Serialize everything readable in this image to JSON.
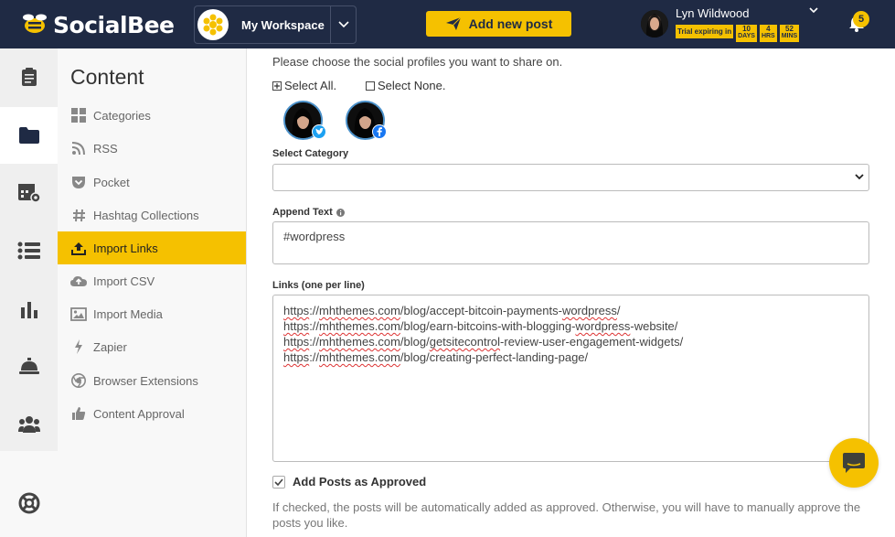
{
  "header": {
    "brand": "SocialBee",
    "workspace_name": "My Workspace",
    "add_post_label": "Add new post",
    "user_name": "Lyn Wildwood",
    "trial_label": "Trial expiring in",
    "trial_days": "10",
    "trial_days_unit": "DAYS",
    "trial_hrs": "4",
    "trial_hrs_unit": "HRS",
    "trial_mins": "52",
    "trial_mins_unit": "MINS",
    "notification_count": "5",
    "accent_color": "#f5c100",
    "bg_color": "#1f2a44"
  },
  "rail": {
    "items": [
      {
        "icon": "clipboard-icon"
      },
      {
        "icon": "folder-icon",
        "active": true
      },
      {
        "icon": "calendar-settings-icon"
      },
      {
        "icon": "list-icon"
      },
      {
        "icon": "bar-chart-icon"
      },
      {
        "icon": "bell-concierge-icon"
      },
      {
        "icon": "users-icon"
      },
      {
        "icon": "lifebuoy-icon"
      }
    ]
  },
  "sidebar": {
    "title": "Content",
    "items": [
      {
        "label": "Categories",
        "icon": "grid-icon"
      },
      {
        "label": "RSS",
        "icon": "rss-icon"
      },
      {
        "label": "Pocket",
        "icon": "pocket-icon"
      },
      {
        "label": "Hashtag Collections",
        "icon": "hashtag-icon"
      },
      {
        "label": "Import Links",
        "icon": "upload-icon",
        "active": true
      },
      {
        "label": "Import CSV",
        "icon": "cloud-upload-icon"
      },
      {
        "label": "Import Media",
        "icon": "image-icon"
      },
      {
        "label": "Zapier",
        "icon": "bolt-icon"
      },
      {
        "label": "Browser Extensions",
        "icon": "chrome-icon"
      },
      {
        "label": "Content Approval",
        "icon": "thumbs-up-icon"
      }
    ]
  },
  "form": {
    "choose_text": "Please choose the social profiles you want to share on.",
    "select_all": "Select All.",
    "select_none": "Select None.",
    "category_label": "Select Category",
    "category_value": "",
    "append_label": "Append Text",
    "append_value": "#wordpress",
    "links_label": "Links (one per line)",
    "links": [
      {
        "p1": "https",
        "p2": "://",
        "p3": "mhthemes.com",
        "p4": "/blog/accept-bitcoin-payments-",
        "p5": "wordpress",
        "p6": "/"
      },
      {
        "p1": "https",
        "p2": "://",
        "p3": "mhthemes.com",
        "p4": "/blog/earn-bitcoins-with-blogging-",
        "p5": "wordpress",
        "p6": "-website/"
      },
      {
        "p1": "https",
        "p2": "://",
        "p3": "mhthemes.com",
        "p4": "/blog/",
        "p5": "getsitecontrol",
        "p6": "-review-user-engagement-widgets/"
      },
      {
        "p1": "https",
        "p2": "://",
        "p3": "mhthemes.com",
        "p4": "/blog/creating-perfect-landing-page/",
        "p5": "",
        "p6": ""
      }
    ],
    "approved_label": "Add Posts as Approved",
    "approved_checked": true,
    "help_text": "If checked, the posts will be automatically added as approved. Otherwise, you will have to manually approve the posts you like."
  }
}
